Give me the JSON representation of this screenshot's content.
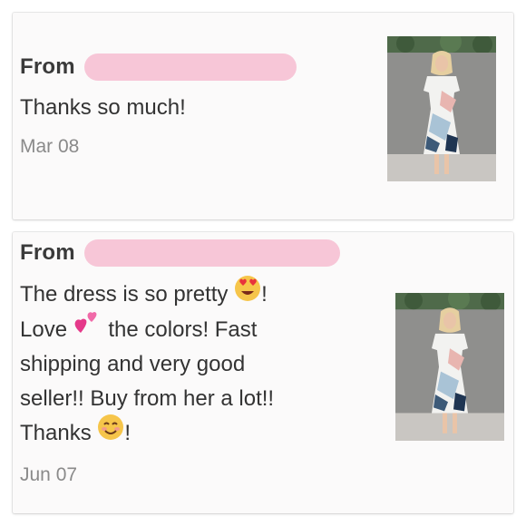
{
  "reviews": [
    {
      "from_label": "From",
      "message_lines": [
        "Thanks so much!"
      ],
      "date": "Mar 08",
      "product_image": "dress-photo"
    },
    {
      "from_label": "From",
      "message_parts": {
        "line1_text": "The dress is so pretty",
        "line1_emoji": "heart-eyes-emoji",
        "line1_tail": "!",
        "line2_start": "Love",
        "line2_emoji": "two-hearts-emoji",
        "line2_tail": " the colors! Fast",
        "line3": "shipping and very good",
        "line4": "seller!! Buy from her a lot!!",
        "line5_text": "Thanks",
        "line5_emoji": "smiling-emoji",
        "line5_tail": "!"
      },
      "date": "Jun 07",
      "product_image": "dress-photo"
    }
  ],
  "colors": {
    "redaction": "#f7c6d7",
    "card_bg": "#fbfafa",
    "text": "#333333",
    "date": "#8a8a8a"
  }
}
